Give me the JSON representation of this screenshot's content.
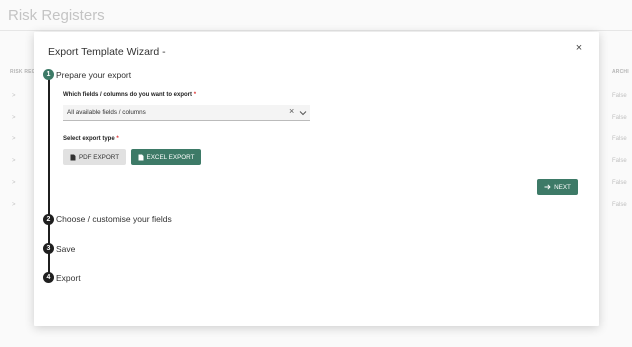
{
  "background": {
    "page_title": "Risk Registers",
    "col_left": "RISK REG",
    "col_right": "ARCHI",
    "row_arrows": [
      ">",
      ">",
      ">",
      ">",
      ">",
      ">"
    ],
    "row_values": [
      "False",
      "False",
      "False",
      "False",
      "False",
      "False"
    ]
  },
  "modal": {
    "title": "Export Template Wizard -",
    "close_icon": "close-icon",
    "steps": [
      {
        "number": "1",
        "label": "Prepare your export",
        "state": "active"
      },
      {
        "number": "2",
        "label": "Choose / customise your fields",
        "state": "pending"
      },
      {
        "number": "3",
        "label": "Save",
        "state": "pending"
      },
      {
        "number": "4",
        "label": "Export",
        "state": "pending"
      }
    ],
    "fields_label": "Which fields / columns do you want to export",
    "required_mark": "*",
    "fields_value": "All available fields / columns",
    "clear_glyph": "×",
    "export_type_label": "Select export type",
    "pdf_button": "PDF EXPORT",
    "excel_button": "EXCEL EXPORT",
    "next_button": "NEXT"
  },
  "colors": {
    "accent": "#3d7a67",
    "step_pending": "#1f1f1f",
    "required": "#dd3333"
  }
}
